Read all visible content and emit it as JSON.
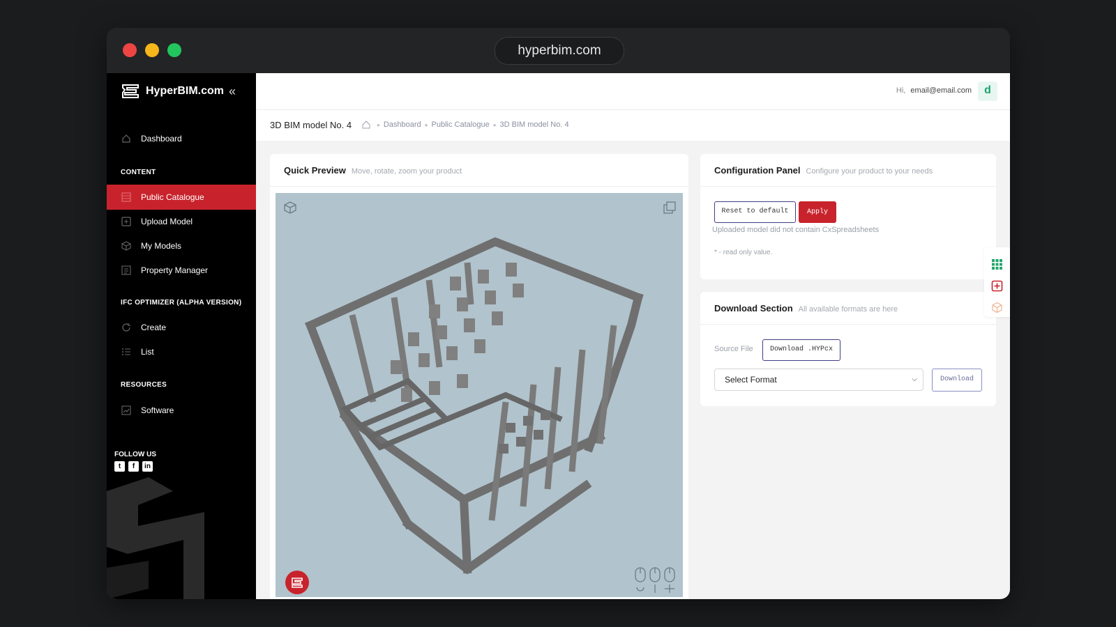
{
  "window": {
    "url": "hyperbim.com"
  },
  "sidebar": {
    "brand": "HyperBIM.com",
    "collapse_icon": "double-chevron-left-icon",
    "items": [
      {
        "label": "Dashboard",
        "icon": "home-icon"
      },
      {
        "label": "Public Catalogue",
        "icon": "grid-icon",
        "active": true
      },
      {
        "label": "Upload Model",
        "icon": "plus-square-icon"
      },
      {
        "label": "My Models",
        "icon": "cube-icon"
      },
      {
        "label": "Property Manager",
        "icon": "list-icon"
      },
      {
        "label": "Create",
        "icon": "refresh-icon"
      },
      {
        "label": "List",
        "icon": "list-bullets-icon"
      },
      {
        "label": "Software",
        "icon": "chart-icon"
      }
    ],
    "sections": [
      "CONTENT",
      "IFC OPTIMIZER (ALPHA VERSION)",
      "RESOURCES"
    ],
    "follow_label": "FOLLOW US",
    "socials": [
      "twitter-icon",
      "facebook-icon",
      "linkedin-icon"
    ]
  },
  "header": {
    "greeting": "Hi,",
    "email": "email@email.com",
    "avatar_letter": "d"
  },
  "breadcrumb": {
    "title": "3D BIM model No. 4",
    "items": [
      "Dashboard",
      "Public Catalogue",
      "3D BIM model No. 4"
    ]
  },
  "preview": {
    "title": "Quick Preview",
    "subtitle": "Move, rotate, zoom your product"
  },
  "config": {
    "title": "Configuration Panel",
    "subtitle": "Configure your product to your needs",
    "reset_label": "Reset to default",
    "apply_label": "Apply",
    "message": "Uploaded model did not contain CxSpreadsheets",
    "note": "* - read only value."
  },
  "download": {
    "title": "Download Section",
    "subtitle": "All available formats are here",
    "source_label": "Source File",
    "source_button": "Download .HYPcx",
    "select_value": "Select Format",
    "download_label": "Download"
  },
  "colors": {
    "accent": "#c8232c",
    "outline": "#3e3d86",
    "viewer_bg": "#b1c3cc"
  }
}
